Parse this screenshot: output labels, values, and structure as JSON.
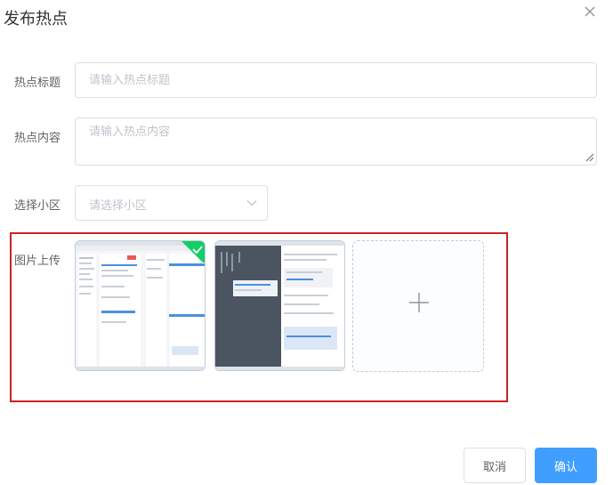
{
  "dialog": {
    "title": "发布热点"
  },
  "form": {
    "title_label": "热点标题",
    "title_placeholder": "请输入热点标题",
    "content_label": "热点内容",
    "content_placeholder": "请输入热点内容",
    "community_label": "选择小区",
    "community_placeholder": "请选择小区",
    "upload_label": "图片上传"
  },
  "footer": {
    "cancel_label": "取消",
    "confirm_label": "确认"
  },
  "colors": {
    "primary": "#409eff",
    "success": "#13ce66",
    "highlight": "#cc2222"
  },
  "icons": {
    "close": "close-icon",
    "select_arrow": "chevron-down-icon",
    "uploaded_check": "check-icon",
    "upload_add": "plus-icon"
  }
}
